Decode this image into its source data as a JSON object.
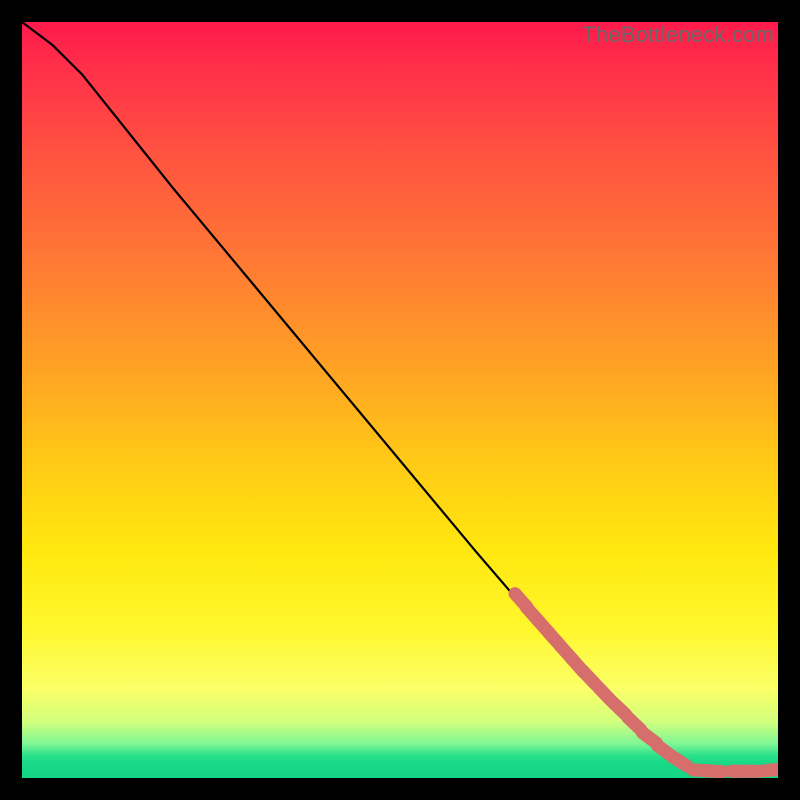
{
  "attribution": "TheBottleneck.com",
  "colors": {
    "marker": "#d66e6b",
    "curve": "#000000",
    "background": "#000000"
  },
  "chart_data": {
    "type": "line",
    "title": "",
    "xlabel": "",
    "ylabel": "",
    "xlim": [
      0,
      100
    ],
    "ylim": [
      0,
      100
    ],
    "curve": [
      {
        "x": 0,
        "y": 100
      },
      {
        "x": 4,
        "y": 97
      },
      {
        "x": 8,
        "y": 93
      },
      {
        "x": 12,
        "y": 88
      },
      {
        "x": 20,
        "y": 78
      },
      {
        "x": 30,
        "y": 66
      },
      {
        "x": 40,
        "y": 54
      },
      {
        "x": 50,
        "y": 42
      },
      {
        "x": 60,
        "y": 30
      },
      {
        "x": 66,
        "y": 23
      },
      {
        "x": 70,
        "y": 18.5
      },
      {
        "x": 74,
        "y": 14
      },
      {
        "x": 78,
        "y": 9.8
      },
      {
        "x": 82,
        "y": 6
      },
      {
        "x": 86,
        "y": 3
      },
      {
        "x": 88,
        "y": 1.7
      },
      {
        "x": 90,
        "y": 1.0
      },
      {
        "x": 92,
        "y": 0.9
      },
      {
        "x": 94,
        "y": 0.9
      },
      {
        "x": 96,
        "y": 0.9
      },
      {
        "x": 98,
        "y": 0.9
      },
      {
        "x": 100,
        "y": 1.1
      }
    ],
    "markers": [
      {
        "x": 66,
        "y": 23.5
      },
      {
        "x": 67.5,
        "y": 21.7
      },
      {
        "x": 69,
        "y": 20
      },
      {
        "x": 70.5,
        "y": 18.3
      },
      {
        "x": 72,
        "y": 16.6
      },
      {
        "x": 73.5,
        "y": 14.9
      },
      {
        "x": 75,
        "y": 13.3
      },
      {
        "x": 77,
        "y": 11.2
      },
      {
        "x": 79,
        "y": 9.2
      },
      {
        "x": 81,
        "y": 7.2
      },
      {
        "x": 83,
        "y": 5.3
      },
      {
        "x": 85,
        "y": 3.6
      },
      {
        "x": 87,
        "y": 2.2
      },
      {
        "x": 90,
        "y": 1.0
      },
      {
        "x": 91.5,
        "y": 0.9
      },
      {
        "x": 95,
        "y": 0.9
      },
      {
        "x": 96.5,
        "y": 0.9
      },
      {
        "x": 99.5,
        "y": 1.1
      }
    ]
  }
}
